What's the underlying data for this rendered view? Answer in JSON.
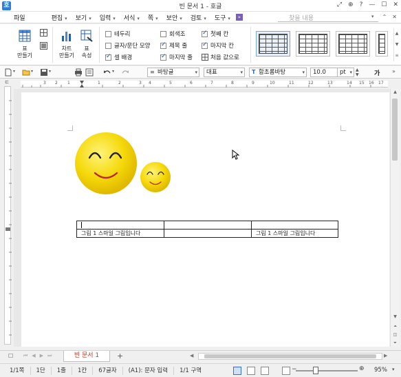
{
  "window": {
    "title": "빈 문서 1 - 호글",
    "app_icon": "호",
    "controls": [
      "⤢",
      "⊕",
      "?",
      "—",
      "☐",
      "✕"
    ]
  },
  "menu": {
    "items": [
      {
        "label": "파일",
        "dropdown": false
      },
      {
        "label": "편집",
        "dropdown": true
      },
      {
        "label": "보기",
        "dropdown": true
      },
      {
        "label": "입력",
        "dropdown": true
      },
      {
        "label": "서식",
        "dropdown": true
      },
      {
        "label": "쪽",
        "dropdown": true
      },
      {
        "label": "보안",
        "dropdown": true
      },
      {
        "label": "검토",
        "dropdown": true
      },
      {
        "label": "도구",
        "dropdown": true
      }
    ],
    "more_label": "»",
    "find_placeholder": "찾을 내용"
  },
  "ribbon": {
    "table_create_label1": "표",
    "table_create_label2": "만들기",
    "chart_label1": "차트",
    "chart_label2": "만들기",
    "table_props_label1": "표",
    "table_props_label2": "속성",
    "checkboxes": [
      {
        "label": "테두리",
        "checked": false
      },
      {
        "label": "글자/문단 모양",
        "checked": false
      },
      {
        "label": "셀 배경",
        "checked": true
      },
      {
        "label": "회색조",
        "checked": false
      },
      {
        "label": "제목 줄",
        "checked": true
      },
      {
        "label": "마지막 줄",
        "checked": true
      },
      {
        "label": "첫째 칸",
        "checked": true
      },
      {
        "label": "마지막 칸",
        "checked": true
      }
    ],
    "reset_label": "처음 값으로"
  },
  "format_toolbar": {
    "style_value": "바탕글",
    "category_value": "대표",
    "font_value": "함초롬바탕",
    "size_value": "10.0",
    "unit_value": "pt",
    "char_btn": "가"
  },
  "ruler": {
    "numbers": [
      "3",
      "2",
      "1",
      "1",
      "2",
      "3",
      "4",
      "5",
      "6",
      "7",
      "8",
      "9",
      "10",
      "11",
      "12",
      "13",
      "14",
      "15",
      "16",
      "17"
    ]
  },
  "document": {
    "table": {
      "rows": [
        [
          "",
          "",
          ""
        ],
        [
          "그림 1  스마일 그림입니다",
          "",
          "그림 1  스마일 그림입니다"
        ]
      ]
    }
  },
  "tabs": {
    "doc_tab": "빈 문서 1",
    "add_tab": "+"
  },
  "status": {
    "page": "1/1쪽",
    "section": "1단",
    "line": "1줄",
    "column": "1칸",
    "chars": "67글자",
    "mode": "(A1): 문자 입력",
    "area": "1/1 구역",
    "zoom": "95%"
  },
  "colors": {
    "smiley_fill": "#f5d90a",
    "smiley_edge": "#e0b800",
    "accent": "#2f7fd8",
    "tab_text": "#c0392b"
  }
}
